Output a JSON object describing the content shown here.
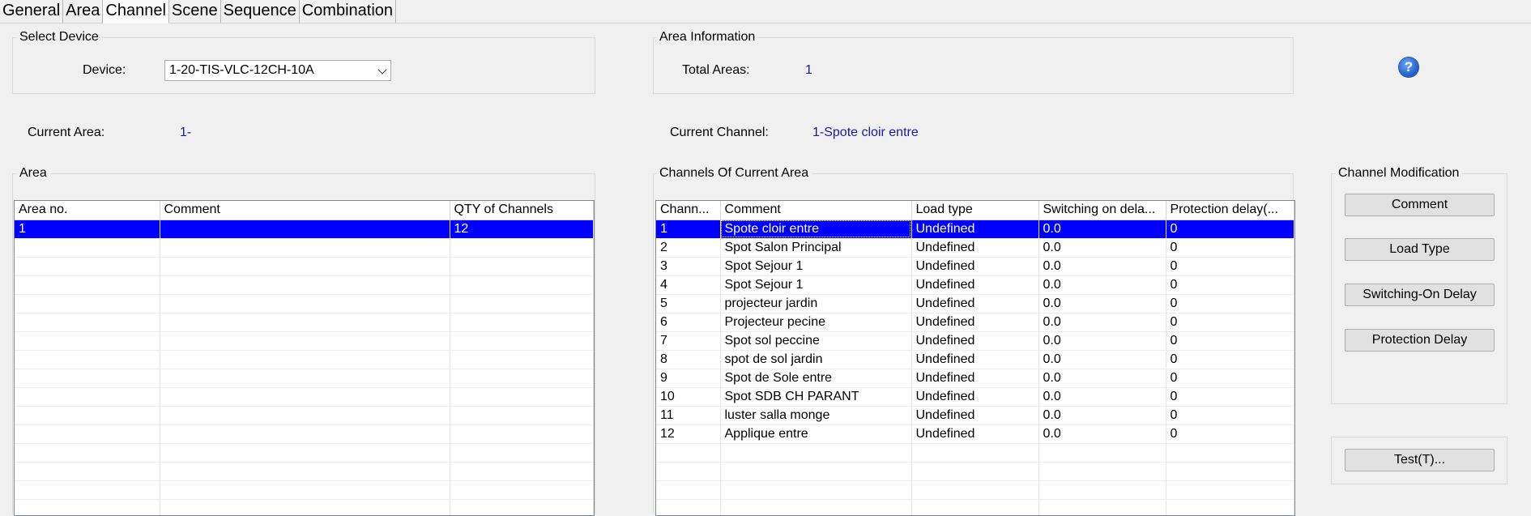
{
  "tabs": [
    {
      "label": "General",
      "active": false
    },
    {
      "label": "Area",
      "active": false
    },
    {
      "label": "Channel",
      "active": true
    },
    {
      "label": "Scene",
      "active": false
    },
    {
      "label": "Sequence",
      "active": false
    },
    {
      "label": "Combination",
      "active": false
    }
  ],
  "select_device": {
    "title": "Select Device",
    "device_label": "Device:",
    "device_value": "1-20-TIS-VLC-12CH-10A"
  },
  "area_info": {
    "title": "Area Information",
    "total_label": "Total Areas:",
    "total_value": "1"
  },
  "help": {
    "icon": "help-icon",
    "glyph": "?"
  },
  "current": {
    "area_label": "Current Area:",
    "area_value": "1-",
    "channel_label": "Current Channel:",
    "channel_value": "1-Spote cloir entre"
  },
  "area_group": {
    "title": "Area",
    "columns": [
      "Area no.",
      "Comment",
      "QTY of Channels"
    ],
    "rows": [
      {
        "no": "1",
        "comment": "",
        "qty": "12",
        "selected": true
      }
    ]
  },
  "channels_group": {
    "title": "Channels Of Current Area",
    "columns": [
      "Chann...",
      "Comment",
      "Load type",
      "Switching on dela...",
      "Protection delay(..."
    ],
    "rows": [
      {
        "no": "1",
        "comment": "Spote cloir entre",
        "load": "Undefined",
        "switching": "0.0",
        "protection": "0",
        "selected": true
      },
      {
        "no": "2",
        "comment": "Spot Salon Principal",
        "load": "Undefined",
        "switching": "0.0",
        "protection": "0"
      },
      {
        "no": "3",
        "comment": "Spot Sejour 1",
        "load": "Undefined",
        "switching": "0.0",
        "protection": "0"
      },
      {
        "no": "4",
        "comment": "Spot Sejour 1",
        "load": "Undefined",
        "switching": "0.0",
        "protection": "0"
      },
      {
        "no": "5",
        "comment": "projecteur jardin",
        "load": "Undefined",
        "switching": "0.0",
        "protection": "0"
      },
      {
        "no": "6",
        "comment": "Projecteur pecine",
        "load": "Undefined",
        "switching": "0.0",
        "protection": "0"
      },
      {
        "no": "7",
        "comment": "Spot sol peccine",
        "load": "Undefined",
        "switching": "0.0",
        "protection": "0"
      },
      {
        "no": "8",
        "comment": "spot de sol jardin",
        "load": "Undefined",
        "switching": "0.0",
        "protection": "0"
      },
      {
        "no": "9",
        "comment": "Spot de Sole entre",
        "load": "Undefined",
        "switching": "0.0",
        "protection": "0"
      },
      {
        "no": "10",
        "comment": "Spot SDB CH PARANT",
        "load": "Undefined",
        "switching": "0.0",
        "protection": "0"
      },
      {
        "no": "11",
        "comment": "luster salla monge",
        "load": "Undefined",
        "switching": "0.0",
        "protection": "0"
      },
      {
        "no": "12",
        "comment": "Applique entre",
        "load": "Undefined",
        "switching": "0.0",
        "protection": "0"
      }
    ]
  },
  "modification": {
    "title": "Channel Modification",
    "buttons": [
      "Comment",
      "Load Type",
      "Switching-On Delay",
      "Protection Delay"
    ]
  },
  "test": {
    "label": "Test(T)..."
  },
  "colors": {
    "selection": "#0000ff",
    "value_text": "#1a1aa6",
    "background": "#f0f0f0"
  }
}
